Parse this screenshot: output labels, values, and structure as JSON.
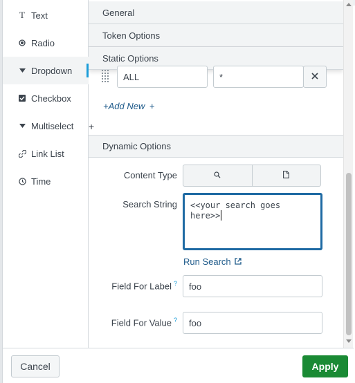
{
  "input_types": [
    {
      "label": "Text",
      "icon": "text-icon"
    },
    {
      "label": "Radio",
      "icon": "radio-icon"
    },
    {
      "label": "Dropdown",
      "icon": "dropdown-caret-icon",
      "selected": true
    },
    {
      "label": "Checkbox",
      "icon": "checkbox-icon"
    },
    {
      "label": "Multiselect",
      "icon": "multiselect-caret-icon"
    },
    {
      "label": "Link List",
      "icon": "link-icon"
    },
    {
      "label": "Time",
      "icon": "clock-icon"
    }
  ],
  "sections": {
    "general": "General",
    "token_options": "Token Options",
    "static_options": "Static Options",
    "dynamic_options": "Dynamic Options"
  },
  "static_option_row": {
    "label_value": "ALL",
    "value_value": "*"
  },
  "add_new_label": "+Add New",
  "dynamic": {
    "content_type_label": "Content Type",
    "search_string_label": "Search String",
    "search_string_value": "<<your search goes here>>",
    "run_search_label": "Run Search",
    "field_for_label_label": "Field For Label",
    "field_for_label_value": "foo",
    "field_for_value_label": "Field For Value",
    "field_for_value_value": "foo",
    "help_mark": "?"
  },
  "footer": {
    "cancel_label": "Cancel",
    "apply_label": "Apply"
  },
  "colors": {
    "accent": "#1a9cd8",
    "apply_green": "#1a8a34",
    "link_blue": "#1e5a8a",
    "focus_border": "#1e6aa3"
  }
}
